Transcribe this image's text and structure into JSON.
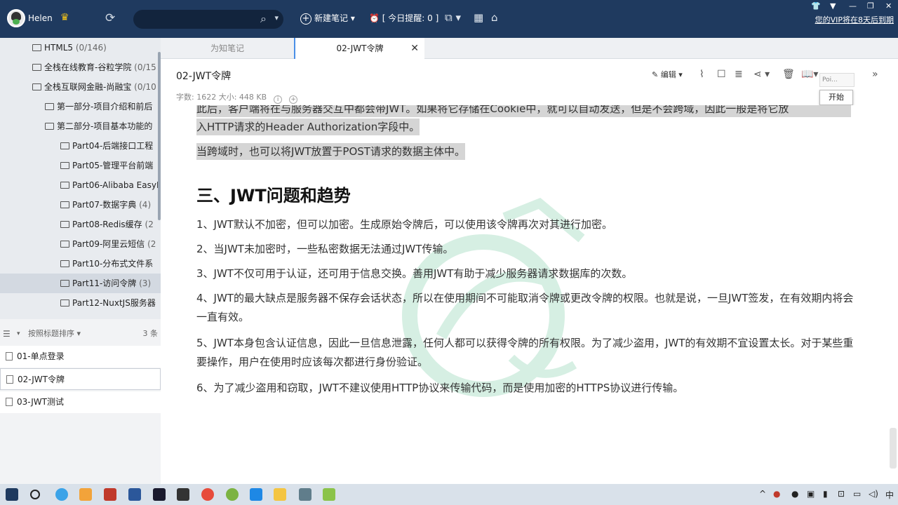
{
  "topbar": {
    "username": "Helen",
    "new_note_label": "新建笔记",
    "reminder_label": "[ 今日提醒: 0 ]",
    "vip_notice": "您的VIP将在8天后到期"
  },
  "sidebar": {
    "tree": [
      {
        "label": "HTML5",
        "count": "(0/146)",
        "level": 1
      },
      {
        "label": "全栈在线教育-谷粒学院",
        "count": "(0/15",
        "level": 1
      },
      {
        "label": "全栈互联网金融-尚融宝",
        "count": "(0/10",
        "level": 1
      },
      {
        "label": "第一部分-项目介绍和前后",
        "count": "",
        "level": 2
      },
      {
        "label": "第二部分-项目基本功能的",
        "count": "",
        "level": 2
      },
      {
        "label": "Part04-后端接口工程",
        "count": "",
        "level": 3
      },
      {
        "label": "Part05-管理平台前端",
        "count": "",
        "level": 3
      },
      {
        "label": "Part06-Alibaba EasyE",
        "count": "",
        "level": 3
      },
      {
        "label": "Part07-数据字典",
        "count": "(4)",
        "level": 3
      },
      {
        "label": "Part08-Redis缓存",
        "count": "(2",
        "level": 3
      },
      {
        "label": "Part09-阿里云短信",
        "count": "(2",
        "level": 3
      },
      {
        "label": "Part10-分布式文件系",
        "count": "",
        "level": 3
      },
      {
        "label": "Part11-访问令牌",
        "count": "(3)",
        "level": 3,
        "active": true
      },
      {
        "label": "Part12-NuxtJS服务器",
        "count": "",
        "level": 3
      }
    ],
    "sort_label": "按照标题排序",
    "note_count": "3 条",
    "notes": [
      "01-单点登录",
      "02-JWT令牌",
      "03-JWT测试"
    ]
  },
  "tabs": [
    {
      "label": "为知笔记",
      "active": false
    },
    {
      "label": "02-JWT令牌",
      "active": true
    }
  ],
  "note": {
    "title": "02-JWT令牌",
    "meta": "字数: 1622    大小: 448 KB",
    "edit_label": "编辑",
    "popup_poi": "Poi...",
    "popup_start": "开始"
  },
  "content": {
    "highlight_lines": [
      "此后，客户端将在与服务器交互中都会带JWT。如果将它存储在Cookie中，就可以自动发送，但是不会跨域，因此一般是将它放",
      "入HTTP请求的Header Authorization字段中。",
      "当跨域时，也可以将JWT放置于POST请求的数据主体中。"
    ],
    "heading": "三、JWT问题和趋势",
    "paragraphs": [
      "1、JWT默认不加密，但可以加密。生成原始令牌后，可以使用该令牌再次对其进行加密。",
      "2、当JWT未加密时，一些私密数据无法通过JWT传输。",
      "3、JWT不仅可用于认证，还可用于信息交换。善用JWT有助于减少服务器请求数据库的次数。",
      "4、JWT的最大缺点是服务器不保存会话状态，所以在使用期间不可能取消令牌或更改令牌的权限。也就是说，一旦JWT签发，在有效期内将会一直有效。",
      "5、JWT本身包含认证信息，因此一旦信息泄露，任何人都可以获得令牌的所有权限。为了减少盗用，JWT的有效期不宜设置太长。对于某些重要操作，用户在使用时应该每次都进行身份验证。",
      "6、为了减少盗用和窃取，JWT不建议使用HTTP协议来传输代码，而是使用加密的HTTPS协议进行传输。"
    ]
  },
  "taskbar": {
    "clock": "中"
  },
  "colors": {
    "topbar": "#1f3a5f",
    "highlight": "#d5d5d5",
    "tab_accent": "#4a8fe7"
  }
}
